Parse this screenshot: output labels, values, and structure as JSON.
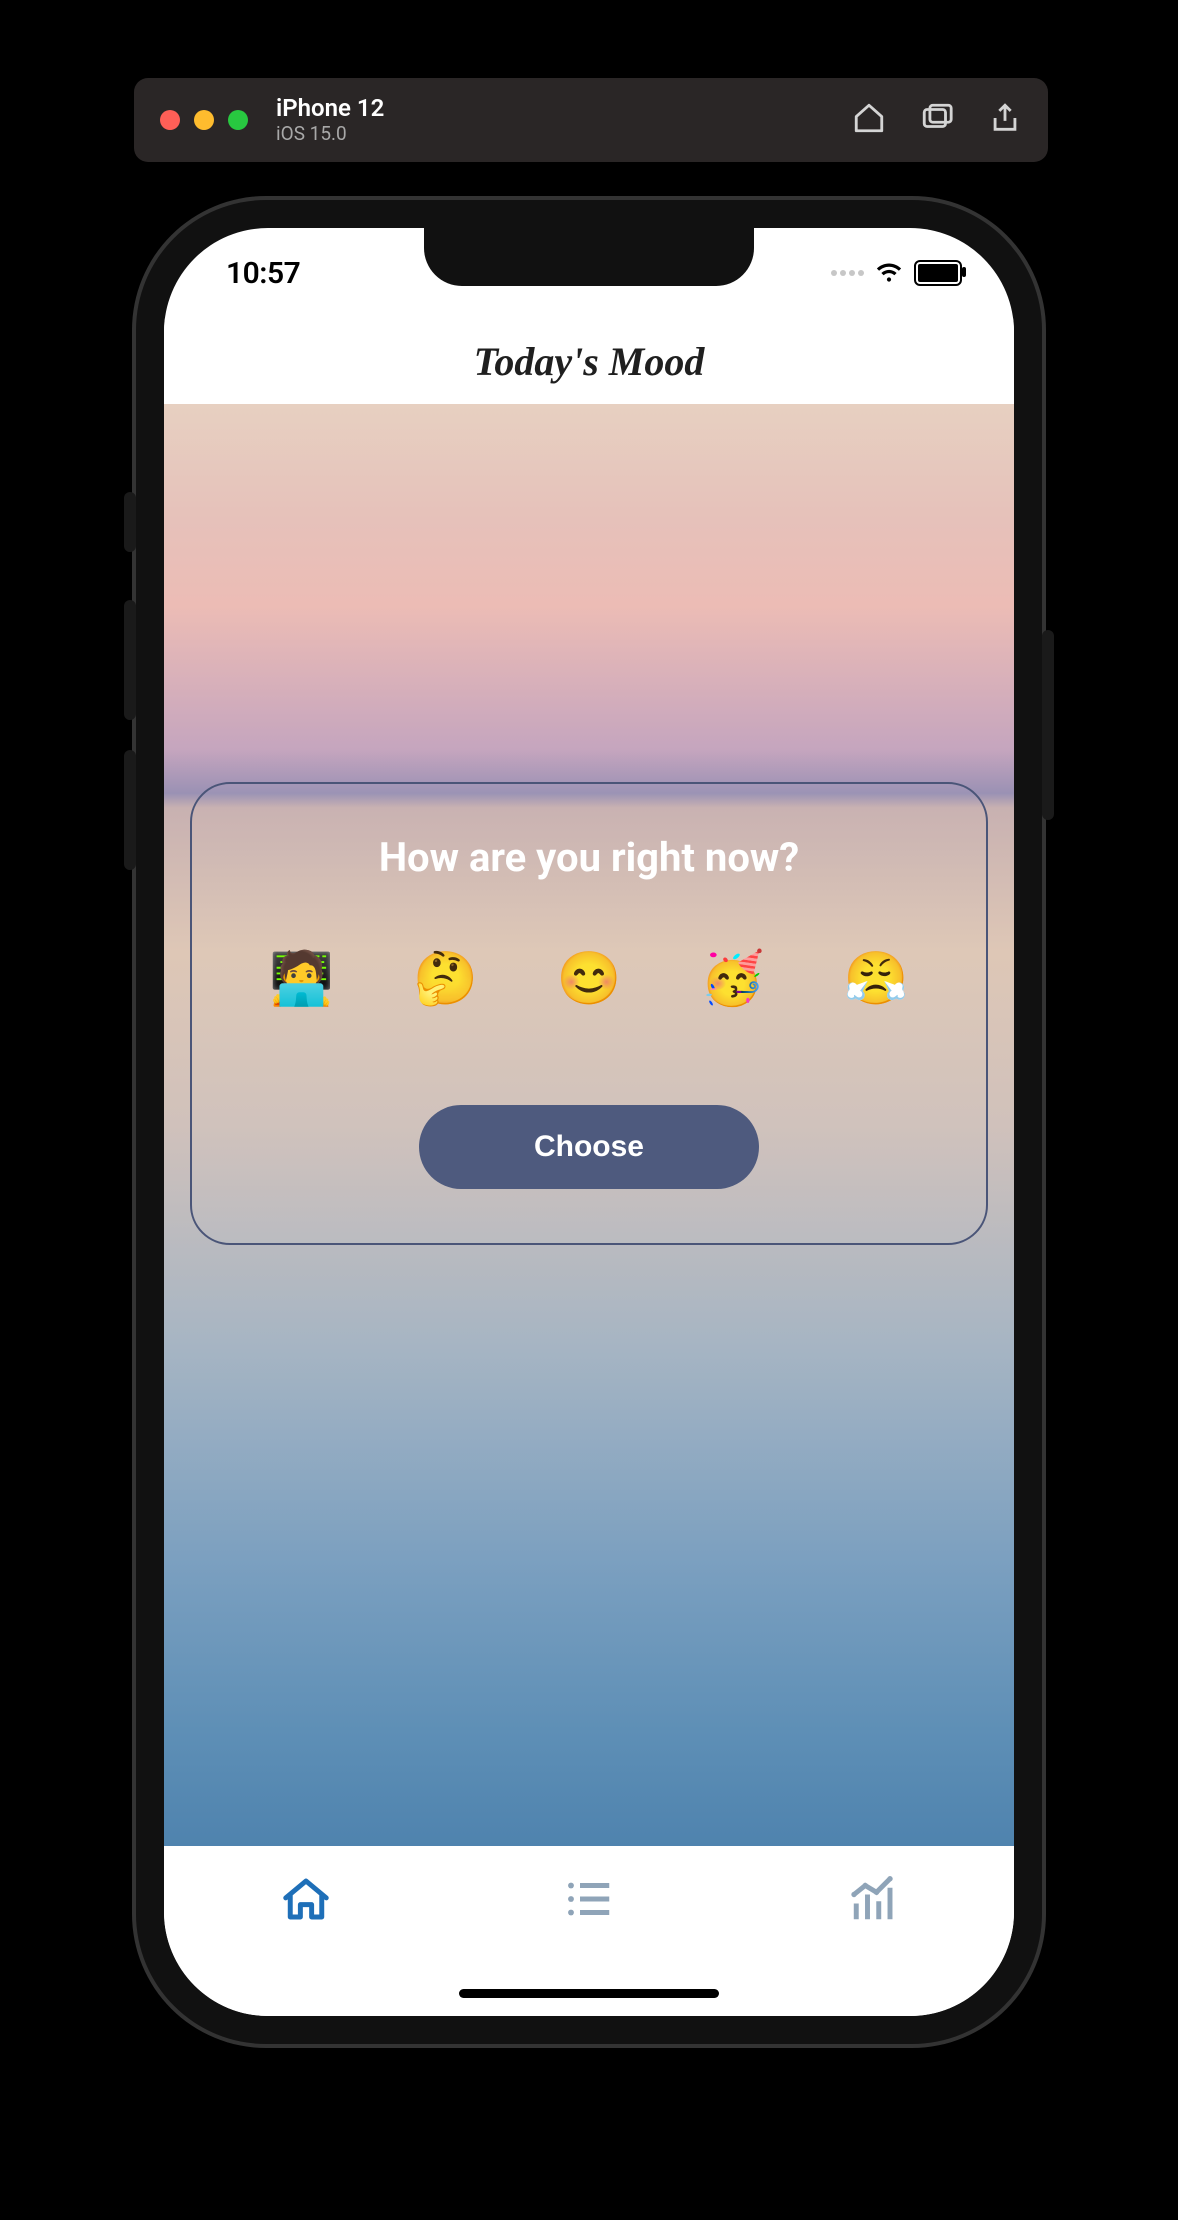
{
  "simulator": {
    "device_name": "iPhone 12",
    "os_version": "iOS 15.0"
  },
  "status_bar": {
    "time": "10:57"
  },
  "header": {
    "title": "Today's Mood"
  },
  "mood_card": {
    "prompt": "How are you right now?",
    "options": [
      {
        "emoji": "🧑‍💻",
        "name": "working"
      },
      {
        "emoji": "🤔",
        "name": "thinking"
      },
      {
        "emoji": "😊",
        "name": "happy"
      },
      {
        "emoji": "🥳",
        "name": "celebrating"
      },
      {
        "emoji": "😤",
        "name": "frustrated"
      }
    ],
    "choose_label": "Choose"
  },
  "tab_bar": {
    "items": [
      {
        "name": "home",
        "active": true
      },
      {
        "name": "list",
        "active": false
      },
      {
        "name": "stats",
        "active": false
      }
    ]
  }
}
